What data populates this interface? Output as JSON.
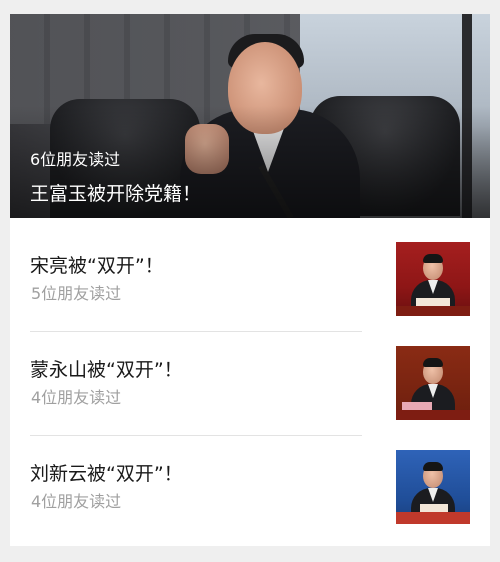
{
  "hero": {
    "readers": "6位朋友读过",
    "title": "王富玉被开除党籍！"
  },
  "items": [
    {
      "title": "宋亮被“双开”！",
      "readers": "5位朋友读过"
    },
    {
      "title": "蒙永山被“双开”！",
      "readers": "4位朋友读过"
    },
    {
      "title": "刘新云被“双开”！",
      "readers": "4位朋友读过"
    }
  ]
}
